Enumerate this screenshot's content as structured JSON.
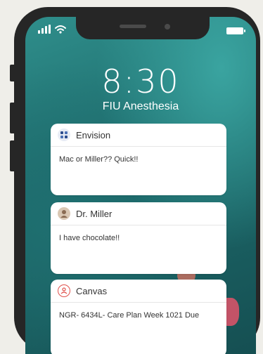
{
  "lockscreen": {
    "time": "8:30",
    "subtitle": "FIU Anesthesia"
  },
  "status_bar": {
    "signal_icon": "signal-bars-icon",
    "wifi_icon": "wifi-icon",
    "battery_icon": "battery-icon"
  },
  "notifications": [
    {
      "app": "Envision",
      "icon": "envision-app-icon",
      "message": "Mac or Miller?? Quick!!"
    },
    {
      "app": "Dr. Miller",
      "icon": "contact-avatar-icon",
      "message": "I have chocolate!!"
    },
    {
      "app": "Canvas",
      "icon": "canvas-app-icon",
      "message": "NGR- 6434L- Care Plan Week 1021 Due"
    }
  ],
  "colors": {
    "background": "#efeee9",
    "phone_frame": "#262626",
    "screen": "#1d6a6b",
    "canvas_accent": "#e0524d",
    "envision_accent": "#2b4b8c"
  }
}
